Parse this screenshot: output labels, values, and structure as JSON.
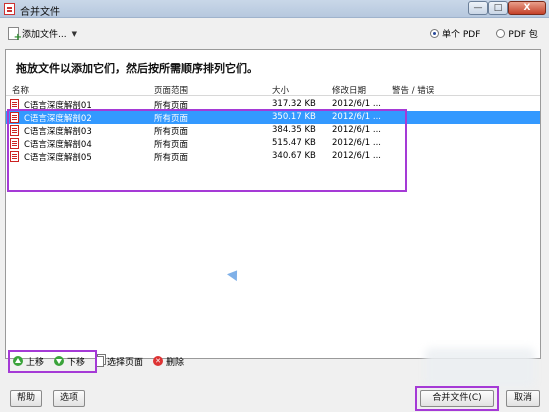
{
  "window": {
    "title": "合并文件",
    "buttons": {
      "minimize": "—",
      "maximize": "□",
      "close": "X"
    }
  },
  "toolbar": {
    "add_files_label": "添加文件...",
    "output_options": [
      {
        "label": "单个 PDF",
        "checked": true
      },
      {
        "label": "PDF 包",
        "checked": false
      }
    ]
  },
  "list": {
    "instruction": "拖放文件以添加它们，然后按所需顺序排列它们。",
    "columns": [
      "名称",
      "页面范围",
      "大小",
      "修改日期",
      "警告 / 错误"
    ],
    "rows": [
      {
        "name": "C语言深度解剖01",
        "range": "所有页面",
        "size": "317.32 KB",
        "date": "2012/6/1 ...",
        "warning": "",
        "selected": false
      },
      {
        "name": "C语言深度解剖02",
        "range": "所有页面",
        "size": "350.17 KB",
        "date": "2012/6/1 ...",
        "warning": "",
        "selected": true
      },
      {
        "name": "C语言深度解剖03",
        "range": "所有页面",
        "size": "384.35 KB",
        "date": "2012/6/1 ...",
        "warning": "",
        "selected": false
      },
      {
        "name": "C语言深度解剖04",
        "range": "所有页面",
        "size": "515.47 KB",
        "date": "2012/6/1 ...",
        "warning": "",
        "selected": false
      },
      {
        "name": "C语言深度解剖05",
        "range": "所有页面",
        "size": "340.67 KB",
        "date": "2012/6/1 ...",
        "warning": "",
        "selected": false
      }
    ]
  },
  "actions": {
    "move_up": "上移",
    "move_down": "下移",
    "choose_pages": "选择页面",
    "delete": "删除"
  },
  "footer": {
    "help": "帮助",
    "options": "选项",
    "merge": "合并文件(C)",
    "cancel": "取消"
  },
  "colors": {
    "selection": "#3399ff",
    "highlight": "#a53ad6"
  }
}
